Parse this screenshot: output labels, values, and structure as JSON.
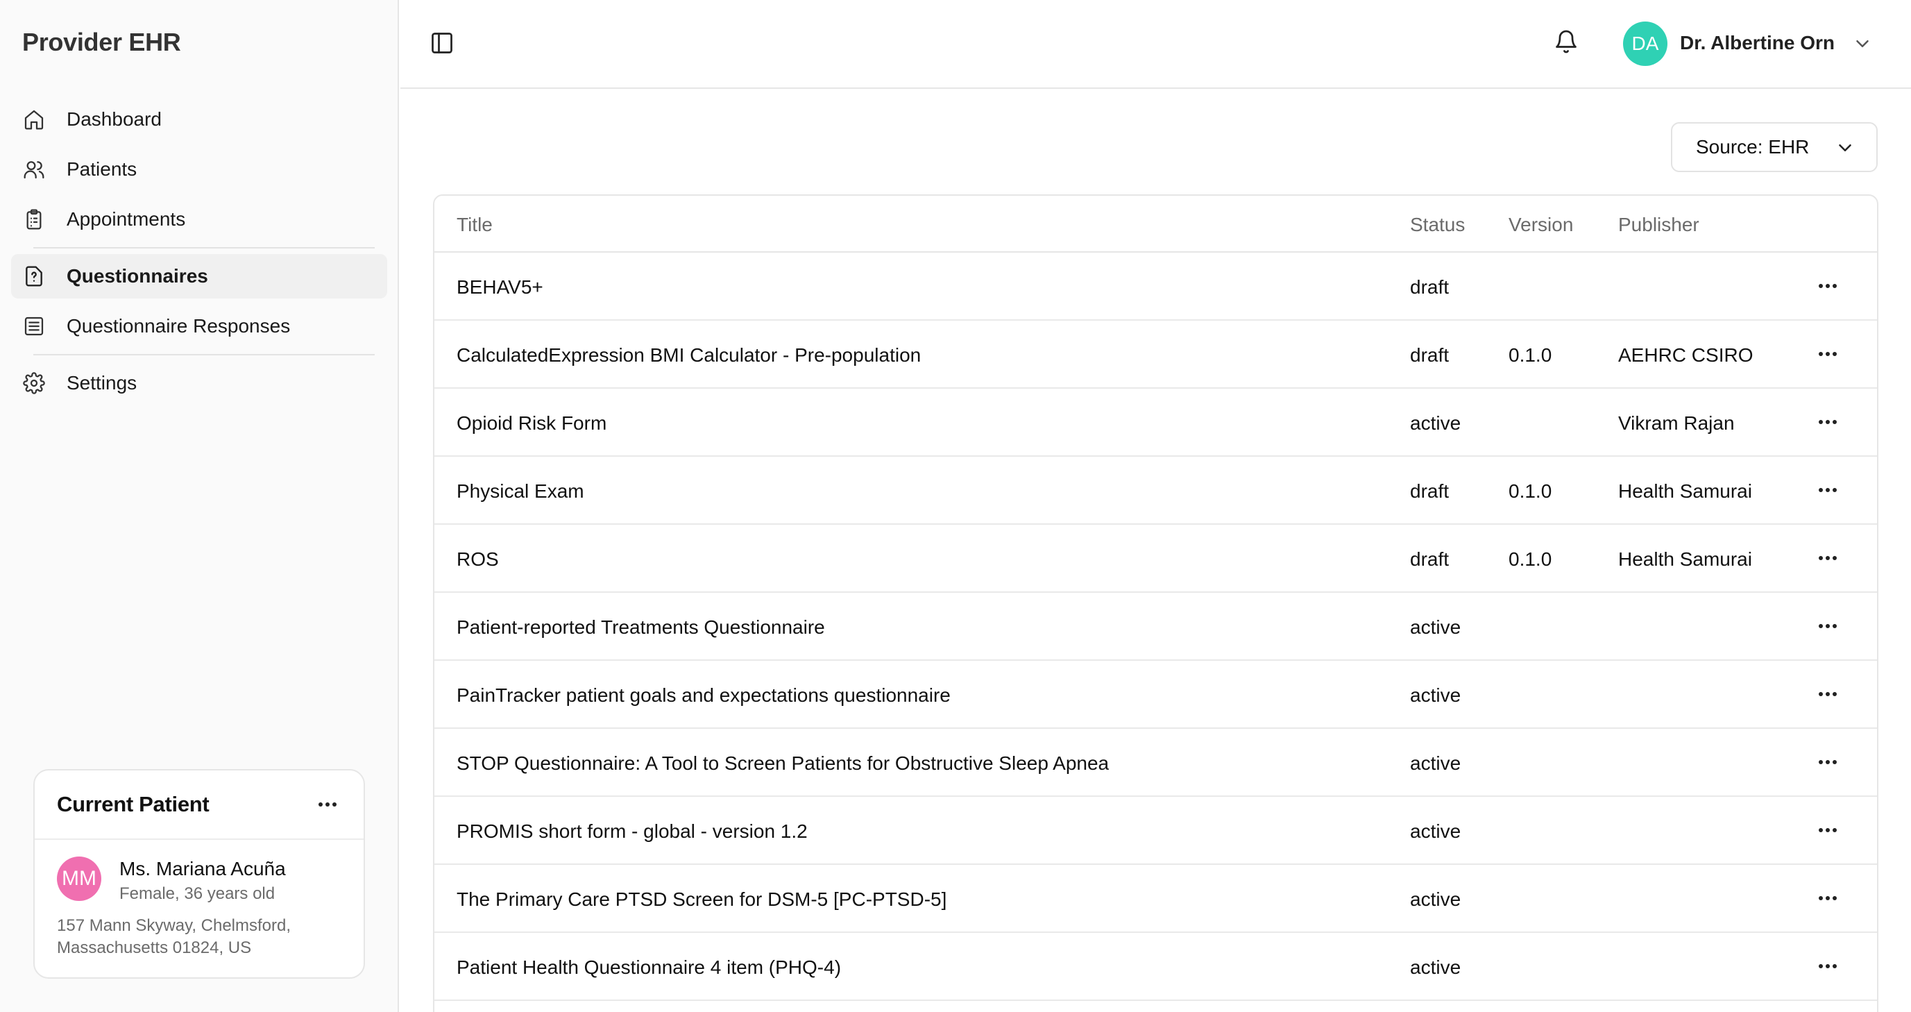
{
  "app": {
    "brand": "Provider EHR"
  },
  "sidebar": {
    "items": [
      {
        "label": "Dashboard",
        "icon": "home-icon"
      },
      {
        "label": "Patients",
        "icon": "users-icon"
      },
      {
        "label": "Appointments",
        "icon": "clipboard-icon"
      },
      {
        "label": "Questionnaires",
        "icon": "file-question-icon",
        "active": true
      },
      {
        "label": "Questionnaire Responses",
        "icon": "list-icon"
      },
      {
        "label": "Settings",
        "icon": "gear-icon"
      }
    ]
  },
  "current_patient": {
    "title": "Current Patient",
    "initials": "MM",
    "name": "Ms. Mariana Acuña",
    "demographics": "Female, 36 years old",
    "address": "157 Mann Skyway, Chelmsford, Massachusetts 01824, US",
    "avatar_color": "#f06fb0"
  },
  "header": {
    "user_initials": "DA",
    "user_name": "Dr. Albertine Orn",
    "avatar_color": "#2fd1b4"
  },
  "source_filter": {
    "label": "Source: EHR"
  },
  "table": {
    "columns": [
      "Title",
      "Status",
      "Version",
      "Publisher"
    ],
    "rows": [
      {
        "title": "BEHAV5+",
        "status": "draft",
        "version": "",
        "publisher": ""
      },
      {
        "title": "CalculatedExpression BMI Calculator - Pre-population",
        "status": "draft",
        "version": "0.1.0",
        "publisher": "AEHRC CSIRO"
      },
      {
        "title": "Opioid Risk Form",
        "status": "active",
        "version": "",
        "publisher": "Vikram Rajan"
      },
      {
        "title": "Physical Exam",
        "status": "draft",
        "version": "0.1.0",
        "publisher": "Health Samurai"
      },
      {
        "title": "ROS",
        "status": "draft",
        "version": "0.1.0",
        "publisher": "Health Samurai"
      },
      {
        "title": "Patient-reported Treatments Questionnaire",
        "status": "active",
        "version": "",
        "publisher": ""
      },
      {
        "title": "PainTracker patient goals and expectations questionnaire",
        "status": "active",
        "version": "",
        "publisher": ""
      },
      {
        "title": "STOP Questionnaire: A Tool to Screen Patients for Obstructive Sleep Apnea",
        "status": "active",
        "version": "",
        "publisher": ""
      },
      {
        "title": "PROMIS short form - global - version 1.2",
        "status": "active",
        "version": "",
        "publisher": ""
      },
      {
        "title": "The Primary Care PTSD Screen for DSM-5 [PC-PTSD-5]",
        "status": "active",
        "version": "",
        "publisher": ""
      },
      {
        "title": "Patient Health Questionnaire 4 item (PHQ-4)",
        "status": "active",
        "version": "",
        "publisher": ""
      }
    ]
  }
}
